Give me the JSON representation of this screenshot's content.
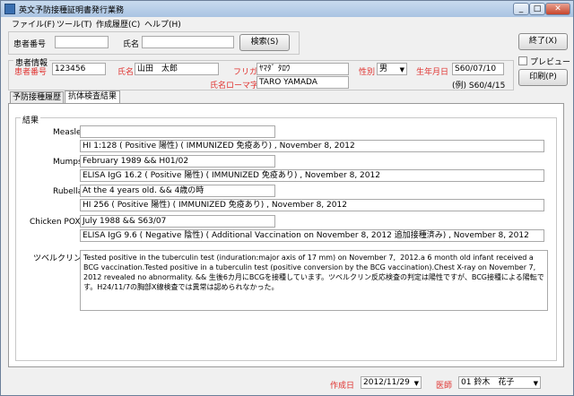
{
  "window": {
    "title": "英文予防接種証明書発行業務",
    "min": "_",
    "max": "□",
    "close": "✕"
  },
  "menu": [
    "ファイル(F)",
    "ツール(T)",
    "作成履歴(C)",
    "ヘルプ(H)"
  ],
  "search": {
    "patient_no_label": "患者番号",
    "name_label": "氏名",
    "search_button": "検索(S)"
  },
  "actions": {
    "exit_button": "終了(X)",
    "preview_label": "プレビュー",
    "print_button": "印刷(P)"
  },
  "patient": {
    "section_label": "患者情報",
    "no_label": "患者番号",
    "no_value": "123456",
    "name_label": "氏名",
    "name_value": "山田　太郎",
    "furigana_label": "フリガナ",
    "furigana_value": "ﾔﾏﾀﾞ ﾀﾛｳ",
    "sex_label": "性別",
    "sex_value": "男",
    "dob_label": "生年月日",
    "dob_value": "S60/07/10",
    "dob_example": "(例) S60/4/15",
    "roman_label": "氏名ローマ字",
    "roman_value": "TARO YAMADA"
  },
  "tabs": [
    "予防接種履歴",
    "抗体検査結果"
  ],
  "results": {
    "section_label": "結果",
    "measles_label": "Measles",
    "measles_1": "",
    "measles_2": "HI 1:128 ( Positive 陽性) ( IMMUNIZED 免疫あり) , November 8,  2012",
    "mumps_label": "Mumps",
    "mumps_1": "February 1989  &&  H01/02",
    "mumps_2": "ELISA IgG  16.2 ( Positive 陽性) ( IMMUNIZED 免疫あり) , November 8,  2012",
    "rubella_label": "Rubella",
    "rubella_1": "At the 4 years old.  &&  4歳の時",
    "rubella_2": "HI  256 ( Positive 陽性) ( IMMUNIZED 免疫あり) , November 8,  2012",
    "chickenpox_label": "Chicken POX",
    "chickenpox_1": "July 1988  &&  S63/07",
    "chickenpox_2": "ELISA IgG  9.6 ( Negative 陰性) ( Additional Vaccination on November 8,  2012 追加接種済み) , November 8,  2012",
    "tuberculin_label": "ツベルクリン反応",
    "tuberculin_text": "Tested positive in the tuberculin test (induration:major axis of 17 mm) on November 7,  2012.a 6 month old infant received a BCG vaccination.Tested positive in a tuberculin test (positive conversion by the BCG vaccination).Chest X-ray on November 7,  2012 revealed no abnormality. && 生後6カ月にBCGを接種しています。ツベルクリン反応検査の判定は陽性ですが、BCG接種による陽転です。H24/11/7の胸部X線検査では異常は認められなかった。"
  },
  "footer": {
    "created_label": "作成日",
    "created_value": "2012/11/29",
    "doctor_label": "医師",
    "doctor_value": "01 鈴木　花子"
  }
}
